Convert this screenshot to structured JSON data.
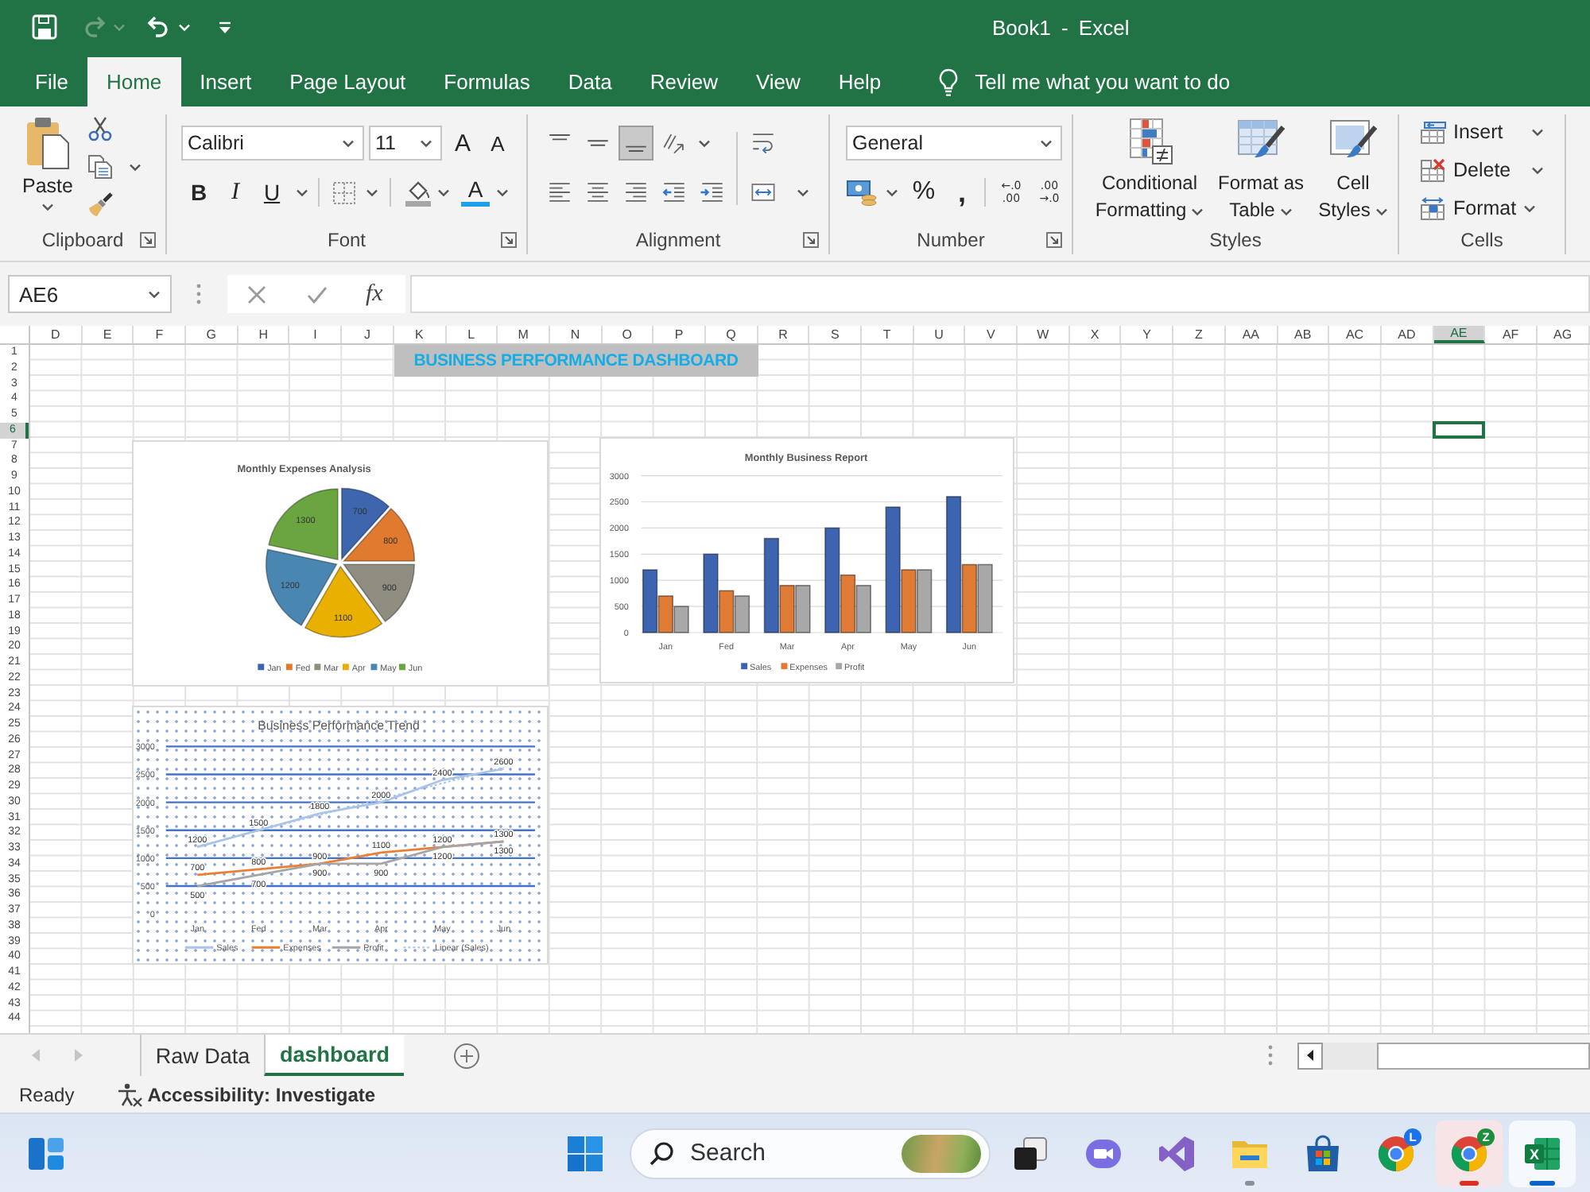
{
  "title_bar": {
    "title": "Book1 - Excel"
  },
  "quick_access": {
    "redo_disabled": true
  },
  "menu_tabs": [
    {
      "label": "File",
      "selected": false
    },
    {
      "label": "Home",
      "selected": true
    },
    {
      "label": "Insert",
      "selected": false
    },
    {
      "label": "Page Layout",
      "selected": false
    },
    {
      "label": "Formulas",
      "selected": false
    },
    {
      "label": "Data",
      "selected": false
    },
    {
      "label": "Review",
      "selected": false
    },
    {
      "label": "View",
      "selected": false
    },
    {
      "label": "Help",
      "selected": false
    }
  ],
  "tell_me": {
    "placeholder": "Tell me what you want to do"
  },
  "ribbon": {
    "clipboard": {
      "label": "Clipboard",
      "paste": "Paste"
    },
    "font": {
      "label": "Font",
      "font_name": "Calibri",
      "font_size": "11",
      "grow_font": "A",
      "shrink_font": "A",
      "bold": "B",
      "italic": "I",
      "underline": "U",
      "font_color": "A"
    },
    "alignment": {
      "label": "Alignment",
      "vertical": [
        {
          "kind": "top",
          "selected": false
        },
        {
          "kind": "middle",
          "selected": false
        },
        {
          "kind": "bottom",
          "selected": true
        }
      ]
    },
    "number": {
      "label": "Number",
      "format": "General",
      "percent": "%",
      "comma": ",",
      "increase_decimal": [
        "←.0",
        ".00"
      ],
      "decrease_decimal": [
        ".00",
        "→.0"
      ]
    },
    "styles": {
      "label": "Styles",
      "buttons": [
        {
          "kind": "conditional",
          "label": "Conditional Formatting"
        },
        {
          "kind": "table",
          "label": "Format as Table"
        },
        {
          "kind": "cell",
          "label": "Cell Styles"
        }
      ]
    },
    "cells": {
      "label": "Cells",
      "buttons": [
        {
          "kind": "insert",
          "label": "Insert"
        },
        {
          "kind": "delete",
          "label": "Delete"
        },
        {
          "kind": "format",
          "label": "Format"
        }
      ]
    }
  },
  "formula_bar": {
    "name_box": "AE6",
    "function_label": "fx"
  },
  "sheet": {
    "columns": [
      {
        "label": "D",
        "selected": false
      },
      {
        "label": "E",
        "selected": false
      },
      {
        "label": "F",
        "selected": false
      },
      {
        "label": "G",
        "selected": false
      },
      {
        "label": "H",
        "selected": false
      },
      {
        "label": "I",
        "selected": false
      },
      {
        "label": "J",
        "selected": false
      },
      {
        "label": "K",
        "selected": false
      },
      {
        "label": "L",
        "selected": false
      },
      {
        "label": "M",
        "selected": false
      },
      {
        "label": "N",
        "selected": false
      },
      {
        "label": "O",
        "selected": false
      },
      {
        "label": "P",
        "selected": false
      },
      {
        "label": "Q",
        "selected": false
      },
      {
        "label": "R",
        "selected": false
      },
      {
        "label": "S",
        "selected": false
      },
      {
        "label": "T",
        "selected": false
      },
      {
        "label": "U",
        "selected": false
      },
      {
        "label": "V",
        "selected": false
      },
      {
        "label": "W",
        "selected": false
      },
      {
        "label": "X",
        "selected": false
      },
      {
        "label": "Y",
        "selected": false
      },
      {
        "label": "Z",
        "selected": false
      },
      {
        "label": "AA",
        "selected": false
      },
      {
        "label": "AB",
        "selected": false
      },
      {
        "label": "AC",
        "selected": false
      },
      {
        "label": "AD",
        "selected": false
      },
      {
        "label": "AE",
        "selected": true
      },
      {
        "label": "AF",
        "selected": false
      },
      {
        "label": "AG",
        "selected": false
      }
    ],
    "rows": [
      {
        "label": "1",
        "selected": false
      },
      {
        "label": "2",
        "selected": false
      },
      {
        "label": "3",
        "selected": false
      },
      {
        "label": "4",
        "selected": false
      },
      {
        "label": "5",
        "selected": false
      },
      {
        "label": "6",
        "selected": true
      },
      {
        "label": "7",
        "selected": false
      },
      {
        "label": "8",
        "selected": false
      },
      {
        "label": "9",
        "selected": false
      },
      {
        "label": "10",
        "selected": false
      },
      {
        "label": "11",
        "selected": false
      },
      {
        "label": "12",
        "selected": false
      },
      {
        "label": "13",
        "selected": false
      },
      {
        "label": "14",
        "selected": false
      },
      {
        "label": "15",
        "selected": false
      },
      {
        "label": "16",
        "selected": false
      },
      {
        "label": "17",
        "selected": false
      },
      {
        "label": "18",
        "selected": false
      },
      {
        "label": "19",
        "selected": false
      },
      {
        "label": "20",
        "selected": false
      },
      {
        "label": "21",
        "selected": false
      },
      {
        "label": "22",
        "selected": false
      },
      {
        "label": "23",
        "selected": false
      },
      {
        "label": "24",
        "selected": false
      },
      {
        "label": "25",
        "selected": false
      },
      {
        "label": "26",
        "selected": false
      },
      {
        "label": "27",
        "selected": false
      },
      {
        "label": "28",
        "selected": false
      },
      {
        "label": "29",
        "selected": false
      },
      {
        "label": "30",
        "selected": false
      },
      {
        "label": "31",
        "selected": false
      },
      {
        "label": "32",
        "selected": false
      },
      {
        "label": "33",
        "selected": false
      },
      {
        "label": "34",
        "selected": false
      },
      {
        "label": "35",
        "selected": false
      },
      {
        "label": "36",
        "selected": false
      },
      {
        "label": "37",
        "selected": false
      },
      {
        "label": "38",
        "selected": false
      },
      {
        "label": "39",
        "selected": false
      },
      {
        "label": "40",
        "selected": false
      },
      {
        "label": "41",
        "selected": false
      },
      {
        "label": "42",
        "selected": false
      },
      {
        "label": "43",
        "selected": false
      },
      {
        "label": "44",
        "selected": false
      }
    ],
    "banner": "BUSINESS PERFORMANCE DASHBOARD"
  },
  "charts": [
    {
      "chart_data": {
        "type": "pie",
        "title": "Monthly Expenses Analysis",
        "categories": [
          "Jan",
          "Fed",
          "Mar",
          "Apr",
          "May",
          "Jun"
        ],
        "values": [
          700,
          800,
          900,
          1100,
          1200,
          1300
        ],
        "data_labels": true,
        "legend": "bottom"
      }
    },
    {
      "chart_data": {
        "type": "bar",
        "title": "Monthly Business Report",
        "categories": [
          "Jan",
          "Fed",
          "Mar",
          "Apr",
          "May",
          "Jun"
        ],
        "series": [
          {
            "name": "Sales",
            "color": "#3c64b0",
            "values": [
              1200,
              1500,
              1800,
              2000,
              2400,
              2600
            ]
          },
          {
            "name": "Expenses",
            "color": "#e07b35",
            "values": [
              700,
              800,
              900,
              1100,
              1200,
              1300
            ]
          },
          {
            "name": "Profit",
            "color": "#a8a8a8",
            "values": [
              500,
              700,
              900,
              900,
              1200,
              1300
            ]
          }
        ],
        "ylim": [
          0,
          3000
        ],
        "yticks": [
          0,
          500,
          1000,
          1500,
          2000,
          2500,
          3000
        ],
        "grid": true,
        "legend": "bottom"
      }
    },
    {
      "chart_data": {
        "type": "line",
        "title": "Business Performance Trend",
        "categories": [
          "Jan",
          "Fed",
          "Mar",
          "Apr",
          "May",
          "Jun"
        ],
        "series": [
          {
            "name": "Sales",
            "color": "#a9c4e8",
            "values": [
              1200,
              1500,
              1800,
              2000,
              2400,
              2600
            ]
          },
          {
            "name": "Expenses",
            "color": "#ed7d31",
            "values": [
              700,
              800,
              900,
              1100,
              1200,
              1300
            ]
          },
          {
            "name": "Profit",
            "color": "#a5a5a5",
            "values": [
              500,
              700,
              900,
              900,
              1200,
              1300
            ]
          }
        ],
        "ylim": [
          0,
          3000
        ],
        "yticks": [
          0,
          500,
          1000,
          1500,
          2000,
          2500,
          3000
        ],
        "data_labels": true,
        "grid": true,
        "legend": "bottom",
        "annotations": [
          {
            "text": "Linear (Sales)"
          }
        ]
      }
    }
  ],
  "sheet_tabs": {
    "nav_disabled": true,
    "tabs": [
      {
        "label": "Raw Data",
        "selected": false
      },
      {
        "label": "dashboard",
        "selected": true
      }
    ]
  },
  "status_bar": {
    "status": "Ready",
    "accessibility": "Accessibility: Investigate"
  },
  "taskbar": {
    "search": {
      "placeholder": "Search"
    },
    "apps": [
      {
        "kind": "task_view",
        "running": false,
        "active": false,
        "flashing": false
      },
      {
        "kind": "video_call",
        "running": false,
        "active": false,
        "flashing": false
      },
      {
        "kind": "studio",
        "running": false,
        "active": false,
        "flashing": false
      },
      {
        "kind": "folder",
        "running": true,
        "active": false,
        "flashing": false
      },
      {
        "kind": "store",
        "running": false,
        "active": false,
        "flashing": false
      },
      {
        "kind": "browser",
        "running": false,
        "active": false,
        "flashing": false,
        "badge": {
          "text": "L",
          "color": "#1a73e8"
        }
      },
      {
        "kind": "browser",
        "running": true,
        "active": false,
        "flashing": true,
        "badge": {
          "text": "Z",
          "color": "#1e8e3e"
        }
      },
      {
        "kind": "spreadsheet",
        "running": true,
        "active": true,
        "flashing": false,
        "logo": "X"
      }
    ]
  }
}
